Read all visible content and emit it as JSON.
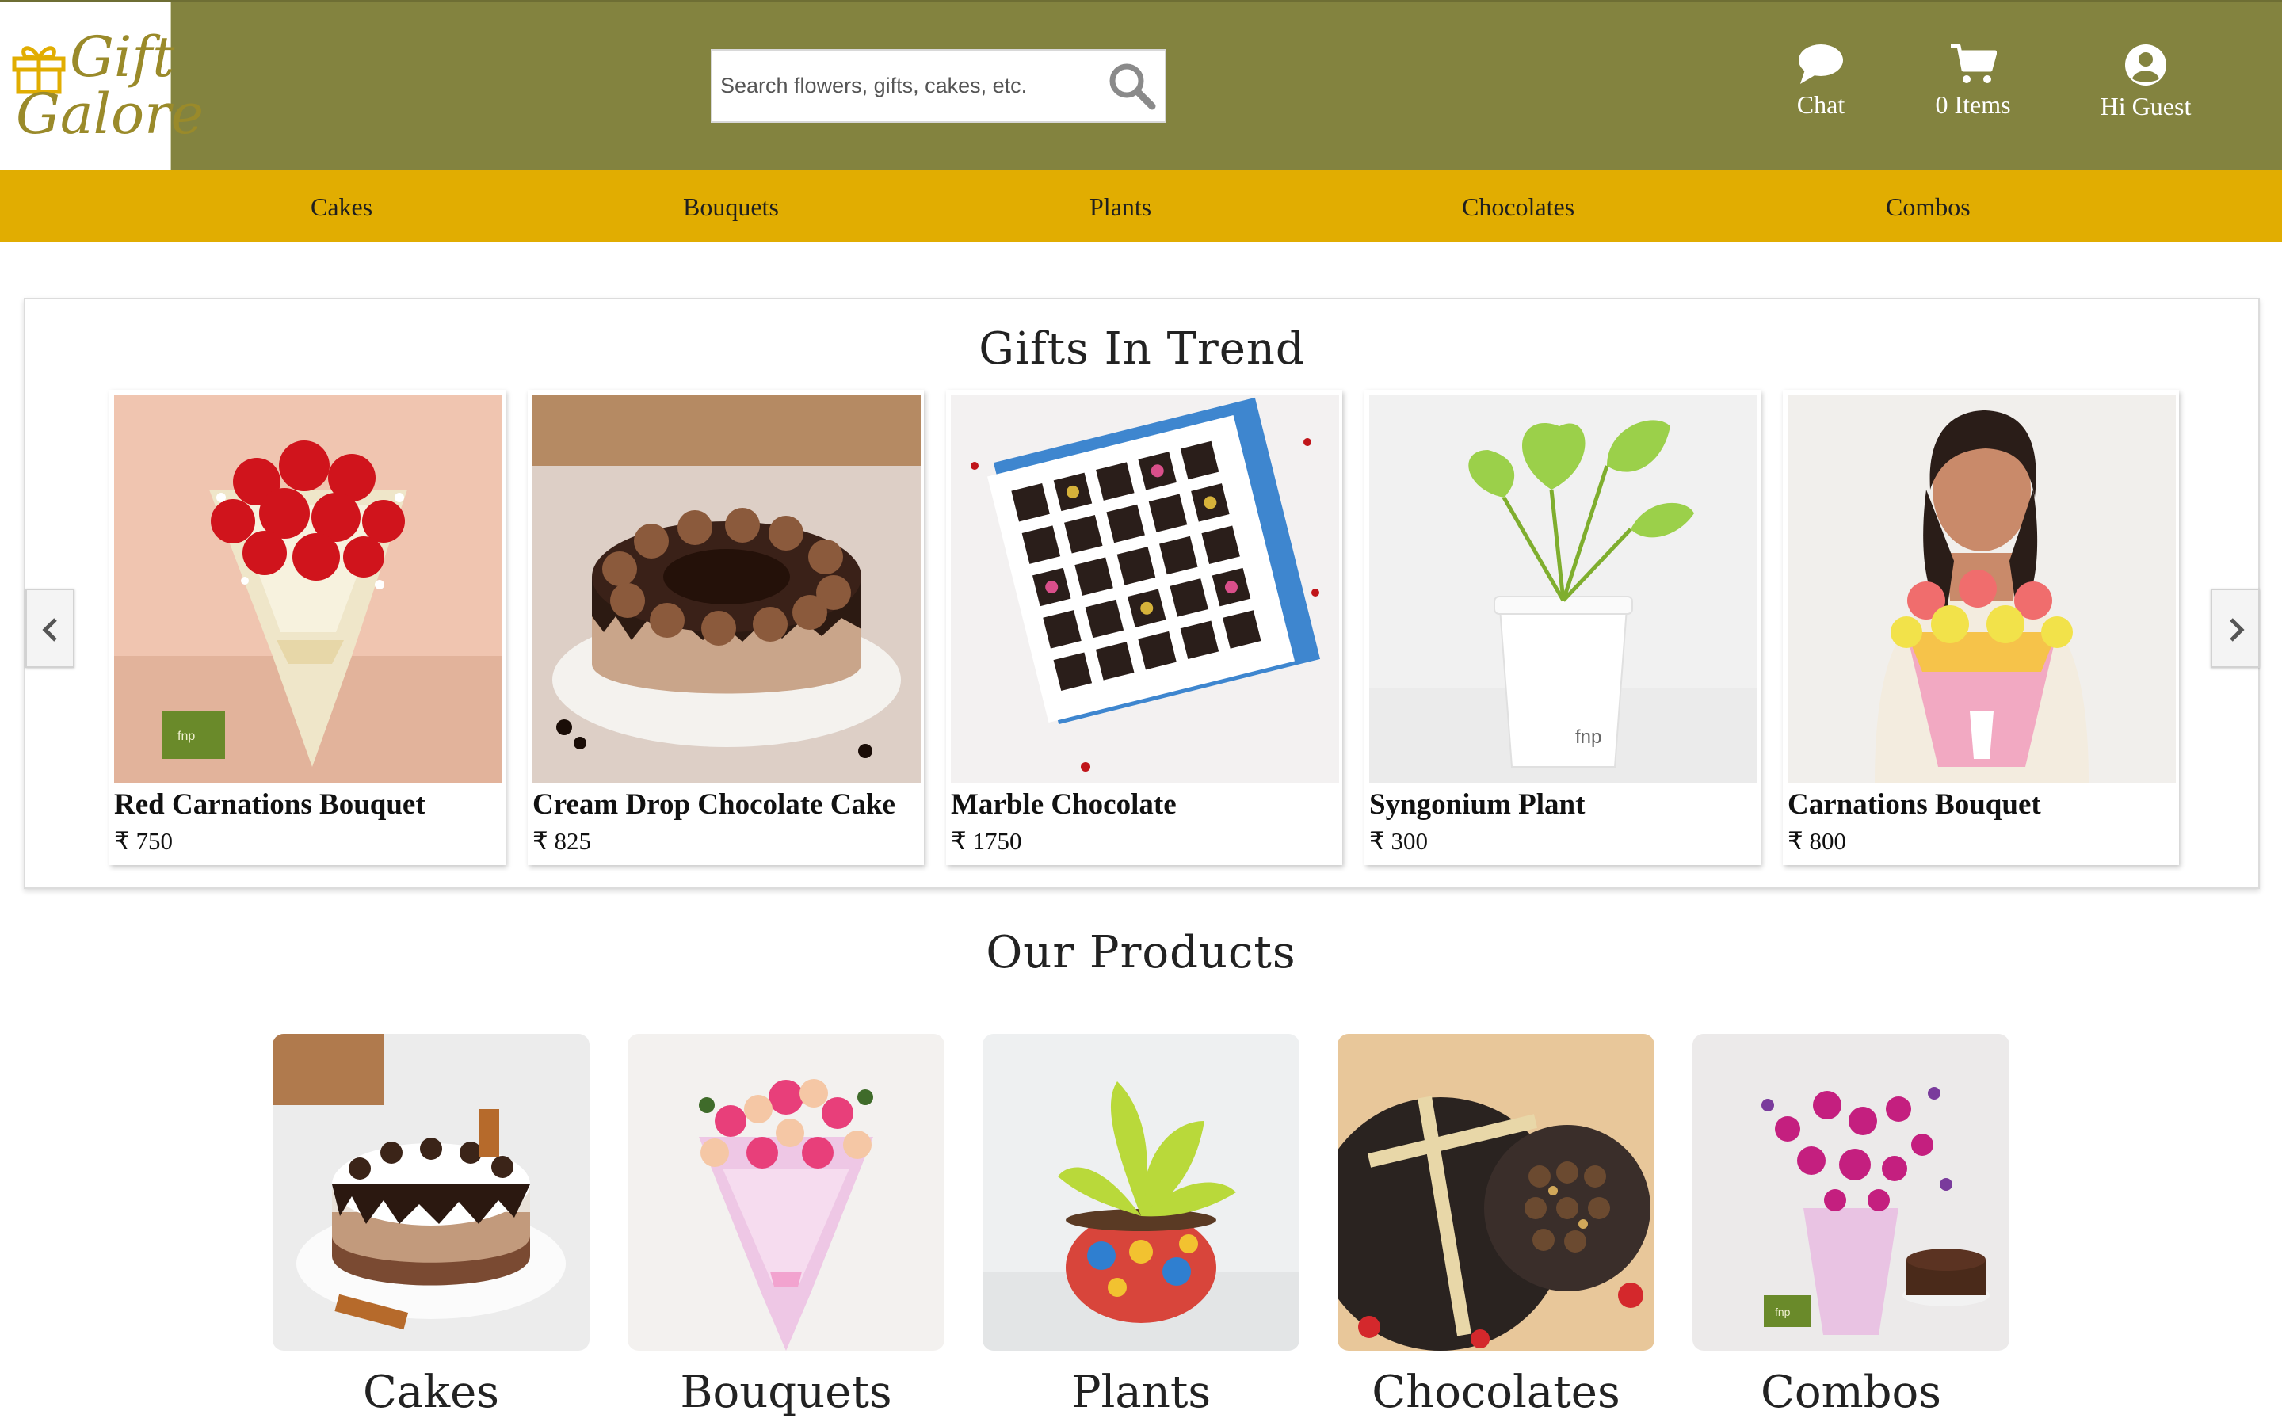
{
  "brand": {
    "line1": "Gift",
    "line2": "Galore"
  },
  "search": {
    "placeholder": "Search flowers, gifts, cakes, etc."
  },
  "header_actions": [
    {
      "icon": "chat-icon",
      "label": "Chat"
    },
    {
      "icon": "cart-icon",
      "label": "0 Items"
    },
    {
      "icon": "user-icon",
      "label": "Hi Guest"
    }
  ],
  "nav": [
    "Cakes",
    "Bouquets",
    "Plants",
    "Chocolates",
    "Combos"
  ],
  "trend": {
    "title": "Gifts In Trend",
    "items": [
      {
        "name": "Red Carnations Bouquet",
        "price": "₹ 750"
      },
      {
        "name": "Cream Drop Chocolate Cake",
        "price": "₹ 825"
      },
      {
        "name": "Marble Chocolate",
        "price": "₹ 1750"
      },
      {
        "name": "Syngonium Plant",
        "price": "₹ 300"
      },
      {
        "name": "Carnations Bouquet",
        "price": "₹ 800"
      }
    ],
    "prev_icon": "chevron-left-icon",
    "next_icon": "chevron-right-icon"
  },
  "products": {
    "title": "Our Products",
    "items": [
      "Cakes",
      "Bouquets",
      "Plants",
      "Chocolates",
      "Combos"
    ]
  },
  "colors": {
    "header": "#83833f",
    "nav": "#e1ad01",
    "brand_text": "#9a8a2a"
  }
}
